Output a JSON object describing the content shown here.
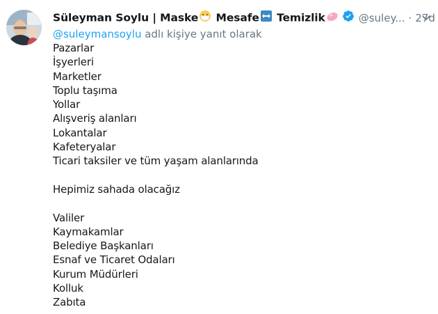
{
  "tweet": {
    "display_name_part1": "Süleyman Soylu | Maske",
    "display_name_part2": " Mesafe",
    "display_name_part3": " Temizlik",
    "emoji_mask": "mask-face-emoji",
    "emoji_arrows": "left-right-arrow-emoji",
    "emoji_soap": "soap-emoji",
    "handle": "@suley...",
    "separator": "·",
    "time": "27d",
    "reply_mention": "@suleymansoylu",
    "reply_suffix": " adlı kişiye yanıt olarak",
    "colors": {
      "link": "#1da1f2",
      "muted": "#657786",
      "text": "#14171a",
      "verified": "#1da1f2"
    }
  },
  "body": {
    "group1": [
      "Pazarlar",
      "İşyerleri",
      "Marketler",
      "Toplu taşıma",
      "Yollar",
      "Alışveriş alanları",
      "Lokantalar",
      "Kafeteryalar",
      "Ticari taksiler ve tüm yaşam alanlarında"
    ],
    "statement": "Hepimiz sahada olacağız",
    "group2": [
      "Valiler",
      "Kaymakamlar",
      "Belediye Başkanları",
      "Esnaf ve Ticaret Odaları",
      "Kurum Müdürleri",
      "Kolluk",
      "Zabıta"
    ]
  }
}
